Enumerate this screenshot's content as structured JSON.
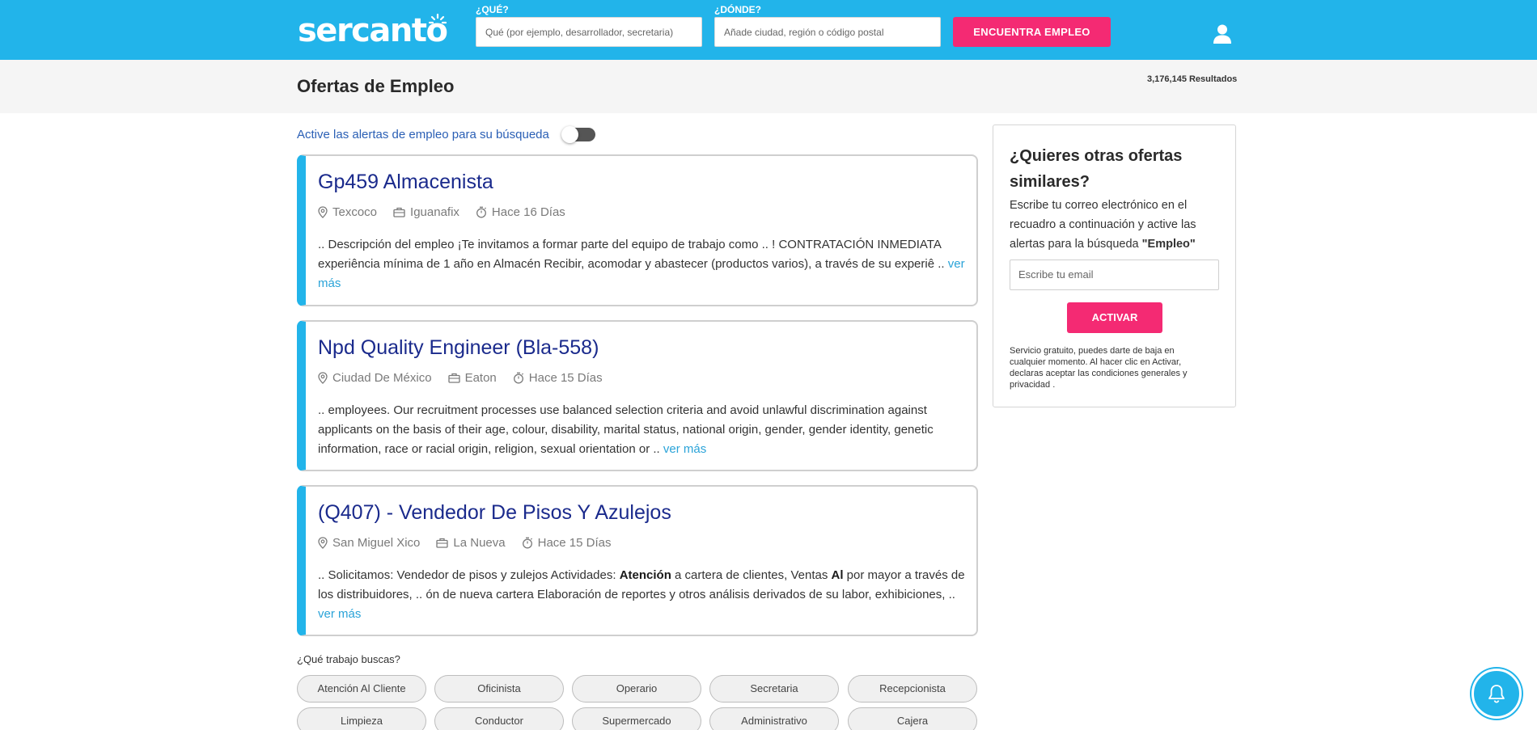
{
  "header": {
    "logo_text": "sercanto",
    "what_label": "¿QUÉ?",
    "what_placeholder": "Qué (por ejemplo, desarrollador, secretaria)",
    "where_label": "¿DÓNDE?",
    "where_placeholder": "Añade ciudad, región o código postal",
    "search_button": "ENCUENTRA EMPLEO",
    "user_icon": "user-icon"
  },
  "page": {
    "title": "Ofertas de Empleo",
    "results": "3,176,145 Resultados",
    "alert_toggle_text": "Active las alertas de empleo para su búsqueda",
    "alert_toggle_on": false
  },
  "jobs": [
    {
      "title": "Gp459 Almacenista",
      "location": "Texcoco",
      "company": "Iguanafix",
      "posted": "Hace 16 Días",
      "desc_parts": [
        ".. Descripción del empleo ¡Te invitamos a formar parte del equipo de trabajo como .. ! CONTRATACIÓN INMEDIATA experiência mínima de 1 año en Almacén Recibir, acomodar y abastecer (productos varios), a través de su experiê .. "
      ],
      "more": "ver más"
    },
    {
      "title": "Npd Quality Engineer (Bla-558)",
      "location": "Ciudad De México",
      "company": "Eaton",
      "posted": "Hace 15 Días",
      "desc_parts": [
        ".. employees. Our recruitment processes use balanced selection criteria and avoid unlawful discrimination against applicants on the basis of their age, colour, disability, marital status, national origin, gender, gender identity, genetic information, race or racial origin, religion, sexual orientation or .. "
      ],
      "more": "ver más"
    },
    {
      "title": "(Q407) - Vendedor De Pisos Y Azulejos",
      "location": "San Miguel Xico",
      "company": "La Nueva",
      "posted": "Hace 15 Días",
      "desc_parts": [
        ".. Solicitamos: Vendedor de pisos y zulejos Actividades: ",
        "Atención",
        " a cartera de clientes, Ventas ",
        "Al",
        " por mayor a través de los distribuidores, .. ón de nueva cartera Elaboración de reportes y otros análisis derivados de su labor, exhibiciones, .. "
      ],
      "more": "ver más"
    }
  ],
  "tags": {
    "label": "¿Qué trabajo buscas?",
    "items": [
      "Atención Al Cliente",
      "Oficinista",
      "Operario",
      "Secretaria",
      "Recepcionista",
      "Limpieza",
      "Conductor",
      "Supermercado",
      "Administrativo",
      "Cajera"
    ]
  },
  "sidebar": {
    "heading": "¿Quieres otras ofertas similares?",
    "text_before": "Escribe tu correo electrónico en el recuadro a continuación y active las alertas para la búsqueda ",
    "query": "\"Empleo\"",
    "email_placeholder": "Escribe tu email",
    "button": "ACTIVAR",
    "legal": "Servicio gratuito, puedes darte de baja en cualquier momento. Al hacer clic en Activar, declaras aceptar las condiciones generales y privacidad ."
  },
  "colors": {
    "brand_blue": "#22b4ea",
    "accent_pink": "#f42a73",
    "title_navy": "#1a2a8c",
    "link_blue": "#2aa3d8"
  }
}
